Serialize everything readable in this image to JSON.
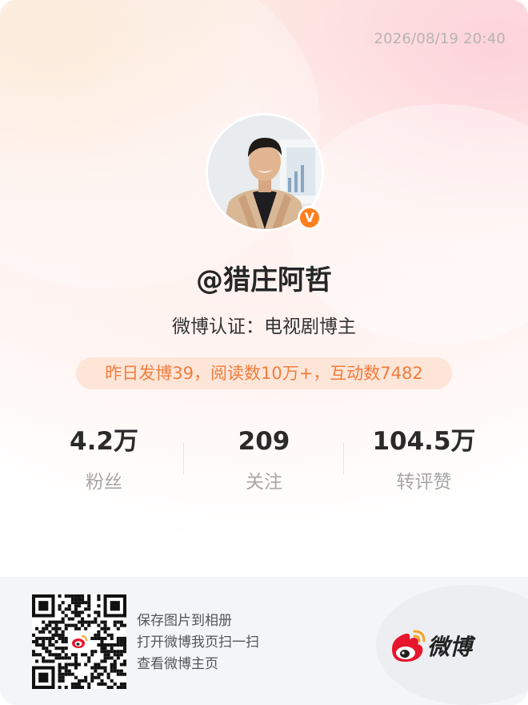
{
  "timestamp": "2026/08/19 20:40",
  "profile": {
    "username": "@猎庄阿哲",
    "certification": "微博认证：电视剧博主",
    "verified_badge": "V",
    "activity": "昨日发博39，阅读数10万+，互动数7482"
  },
  "stats": [
    {
      "value": "4.2万",
      "label": "粉丝"
    },
    {
      "value": "209",
      "label": "关注"
    },
    {
      "value": "104.5万",
      "label": "转评赞"
    }
  ],
  "footer": {
    "lines": [
      "保存图片到相册",
      "打开微博我页扫一扫",
      "查看微博主页"
    ],
    "brand": "微博"
  },
  "colors": {
    "accent_orange": "#f07d3d",
    "badge_orange": "#ff7f1f",
    "weibo_red": "#e6162d",
    "weibo_orange": "#f5a623"
  },
  "icons": {
    "verified": "verified-badge-icon",
    "qr": "qr-code-icon",
    "brand": "weibo-logo-icon"
  }
}
